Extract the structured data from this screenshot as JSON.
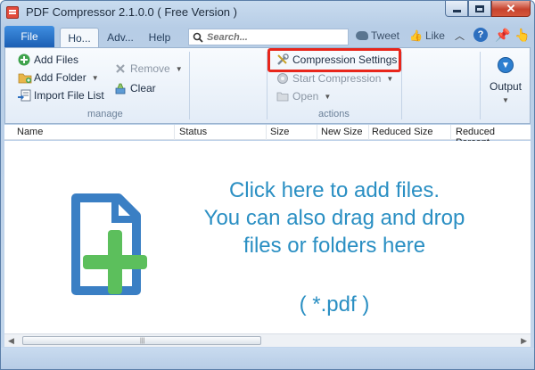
{
  "window": {
    "title": "PDF Compressor 2.1.0.0 ( Free Version )"
  },
  "tabs": {
    "file": "File",
    "home": "Ho...",
    "advanced": "Adv...",
    "help": "Help"
  },
  "search": {
    "placeholder": "Search..."
  },
  "social": {
    "tweet": "Tweet",
    "like": "Like"
  },
  "manage": {
    "label": "manage",
    "add_files": "Add Files",
    "add_folder": "Add Folder",
    "import_list": "Import File List",
    "remove": "Remove",
    "clear": "Clear"
  },
  "actions": {
    "label": "actions",
    "compression_settings": "Compression Settings",
    "start_compression": "Start Compression",
    "open": "Open"
  },
  "output": {
    "label": "Output"
  },
  "columns": [
    "Name",
    "Status",
    "Size",
    "New Size",
    "Reduced Size",
    "Reduced Percent"
  ],
  "drop": {
    "line1": "Click here to add files.",
    "line2": "You can also drag and drop",
    "line3": "files or folders here",
    "ext": "( *.pdf )"
  },
  "colors": {
    "accent": "#2a8fc3",
    "highlight": "#e8261b",
    "plus": "#5cbf5c",
    "doc": "#3a7fc4"
  }
}
